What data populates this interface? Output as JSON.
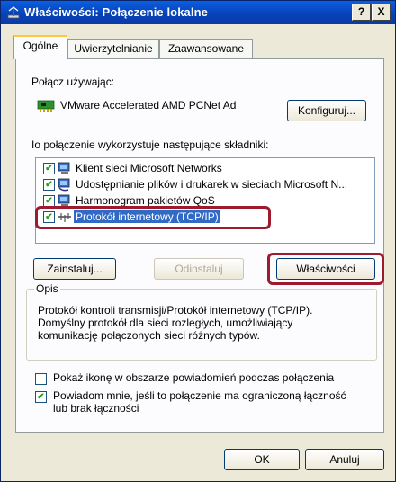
{
  "window": {
    "title": "Właściwości: Połączenie lokalne",
    "help_label": "?",
    "close_label": "X"
  },
  "tabs": [
    {
      "label": "Ogólne",
      "active": true
    },
    {
      "label": "Uwierzytelnianie",
      "active": false
    },
    {
      "label": "Zaawansowane",
      "active": false
    }
  ],
  "connect_using": {
    "label": "Połącz używając:",
    "adapter": "VMware Accelerated AMD PCNet Ad",
    "configure_label": "Konfiguruj..."
  },
  "components": {
    "label": "Io połączenie wykorzystuje następujące składniki:",
    "items": [
      {
        "label": "Klient sieci Microsoft Networks",
        "checked": true,
        "icon": "network-client-icon",
        "selected": false
      },
      {
        "label": "Udostępnianie plików i drukarek w sieciach Microsoft N...",
        "checked": true,
        "icon": "file-printer-sharing-icon",
        "selected": false
      },
      {
        "label": "Harmonogram pakietów QoS",
        "checked": true,
        "icon": "qos-scheduler-icon",
        "selected": false
      },
      {
        "label": "Protokół internetowy (TCP/IP)",
        "checked": true,
        "icon": "protocol-icon",
        "selected": true
      }
    ]
  },
  "buttons": {
    "install": "Zainstaluj...",
    "uninstall": "Odinstaluj",
    "properties": "Właściwości",
    "ok": "OK",
    "cancel": "Anuluj"
  },
  "description": {
    "legend": "Opis",
    "text": "Protokół kontroli transmisji/Protokół internetowy (TCP/IP).\nDomyślny protokół dla sieci rozległych, umożliwiający\nkomunikację połączonych sieci różnych typów."
  },
  "options": {
    "show_icon": {
      "label": "Pokaż ikonę w obszarze powiadomień podczas połączenia",
      "checked": false
    },
    "notify": {
      "label": "Powiadom mnie, jeśli to połączenie ma ograniczoną łączność\nlub brak łączności",
      "checked": true
    }
  },
  "colors": {
    "titlebar": "#0842b8",
    "selection": "#316ac5",
    "highlight": "#9c1b2e",
    "tab_accent": "#ffc83c"
  }
}
